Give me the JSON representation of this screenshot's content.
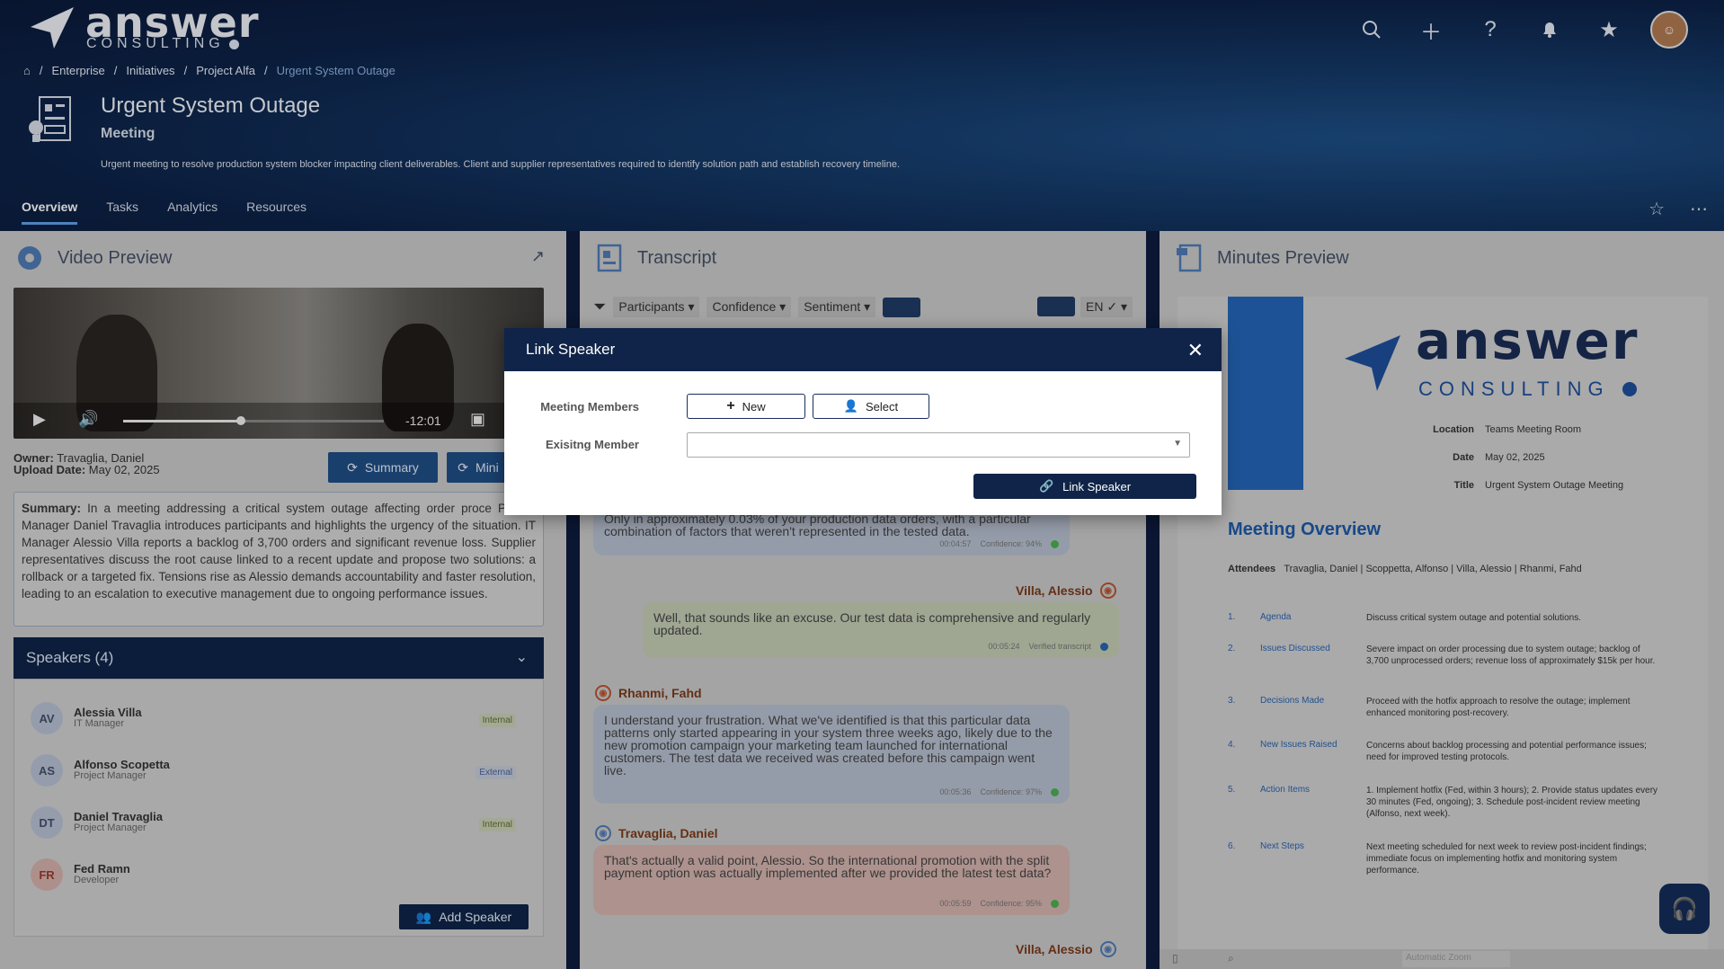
{
  "brand": {
    "name": "answer",
    "sub": "CONSULTING"
  },
  "breadcrumb": [
    "Enterprise",
    "Initiatives",
    "Project Alfa",
    "Urgent System Outage"
  ],
  "page": {
    "title": "Urgent System Outage",
    "type": "Meeting",
    "description": "Urgent meeting to resolve production system blocker impacting client deliverables. Client and supplier representatives required to identify solution path and establish recovery timeline."
  },
  "tabs": [
    "Overview",
    "Tasks",
    "Analytics",
    "Resources"
  ],
  "video_panel": {
    "title": "Video Preview",
    "time": "-12:01",
    "progress": 0.45,
    "owner_label": "Owner:",
    "owner": "Travaglia, Daniel",
    "upload_label": "Upload Date:",
    "upload": "May 02, 2025",
    "summary_btn": "Summary",
    "minutes_btn": "Mini",
    "summary_label": "Summary:",
    "summary": "In a meeting addressing a critical system outage affecting order proce Project Manager Daniel Travaglia introduces participants and highlights the urgency of the situation. IT Manager Alessio Villa reports a backlog of 3,700 orders and significant revenue loss. Supplier representatives discuss the root cause linked to a recent update and propose two solutions: a rollback or a targeted fix. Tensions rise as Alessio demands accountability and faster resolution, leading to an escalation to executive management due to ongoing performance issues.",
    "speakers_title": "Speakers (4)",
    "speakers": [
      {
        "initials": "AV",
        "name": "Alessia Villa",
        "role": "IT Manager",
        "tag": "Internal"
      },
      {
        "initials": "AS",
        "name": "Alfonso Scopetta",
        "role": "Project Manager",
        "tag": "External"
      },
      {
        "initials": "DT",
        "name": "Daniel Travaglia",
        "role": "Project Manager",
        "tag": "Internal"
      },
      {
        "initials": "FR",
        "name": "Fed Ramn",
        "role": "Developer",
        "tag": ""
      }
    ],
    "add_speaker": "Add Speaker"
  },
  "transcript_panel": {
    "title": "Transcript",
    "filters": [
      "Participants ▾",
      "Confidence ▾",
      "Sentiment ▾"
    ],
    "lang": "EN ✓ ▾",
    "messages": [
      {
        "text": "Only in approximately 0.03% of your production data orders, with a particular combination of factors that weren't represented in the tested data.",
        "time": "00:04:57",
        "meta": "Confidence: 94%"
      },
      {
        "speaker": "Villa, Alessio",
        "text": "Well, that sounds like an excuse. Our test data is comprehensive and regularly updated.",
        "time": "00:05:24",
        "meta": "Verified transcript"
      },
      {
        "speaker": "Rhanmi, Fahd",
        "text": "I understand your frustration. What we've identified is that this particular data patterns only started appearing in your system three weeks ago, likely due to the new promotion campaign your marketing team launched for international customers. The test data we received was created before this campaign went live.",
        "time": "00:05:36",
        "meta": "Confidence: 97%"
      },
      {
        "speaker": "Travaglia, Daniel",
        "text": "That's actually a valid point, Alessio. So the international promotion with the split payment option was actually implemented after we provided the latest test data?",
        "time": "00:05:59",
        "meta": "Confidence: 95%"
      },
      {
        "speaker": "Villa, Alessio"
      }
    ]
  },
  "minutes_panel": {
    "title": "Minutes Preview",
    "location_label": "Location",
    "location": "Teams Meeting Room",
    "date_label": "Date",
    "date": "May 02, 2025",
    "title_label": "Title",
    "meeting_title": "Urgent System Outage Meeting",
    "overview_title": "Meeting Overview",
    "attendees_label": "Attendees",
    "attendees": "Travaglia, Daniel | Scoppetta, Alfonso | Villa, Alessio | Rhanmi, Fahd",
    "items": [
      {
        "n": "1.",
        "t": "Agenda",
        "d": "Discuss critical system outage and potential solutions."
      },
      {
        "n": "2.",
        "t": "Issues Discussed",
        "d": "Severe impact on order processing due to system outage; backlog of 3,700 unprocessed orders; revenue loss of approximately $15k per hour."
      },
      {
        "n": "3.",
        "t": "Decisions Made",
        "d": "Proceed with the hotfix approach to resolve the outage; implement enhanced monitoring post-recovery."
      },
      {
        "n": "4.",
        "t": "New Issues Raised",
        "d": "Concerns about backlog processing and potential performance issues; need for improved testing protocols."
      },
      {
        "n": "5.",
        "t": "Action Items",
        "d": "1. Implement hotfix (Fed, within 3 hours); 2. Provide status updates every 30 minutes (Fed, ongoing); 3. Schedule post-incident review meeting (Alfonso, next week)."
      },
      {
        "n": "6.",
        "t": "Next Steps",
        "d": "Next meeting scheduled for next week to review post-incident findings; immediate focus on implementing hotfix and monitoring system performance."
      }
    ],
    "zoom_label": "Automatic Zoom"
  },
  "modal": {
    "title": "Link Speaker",
    "members_label": "Meeting Members",
    "new_btn": "New",
    "select_btn": "Select",
    "existing_label": "Exisitng Member",
    "link_btn": "Link Speaker"
  }
}
